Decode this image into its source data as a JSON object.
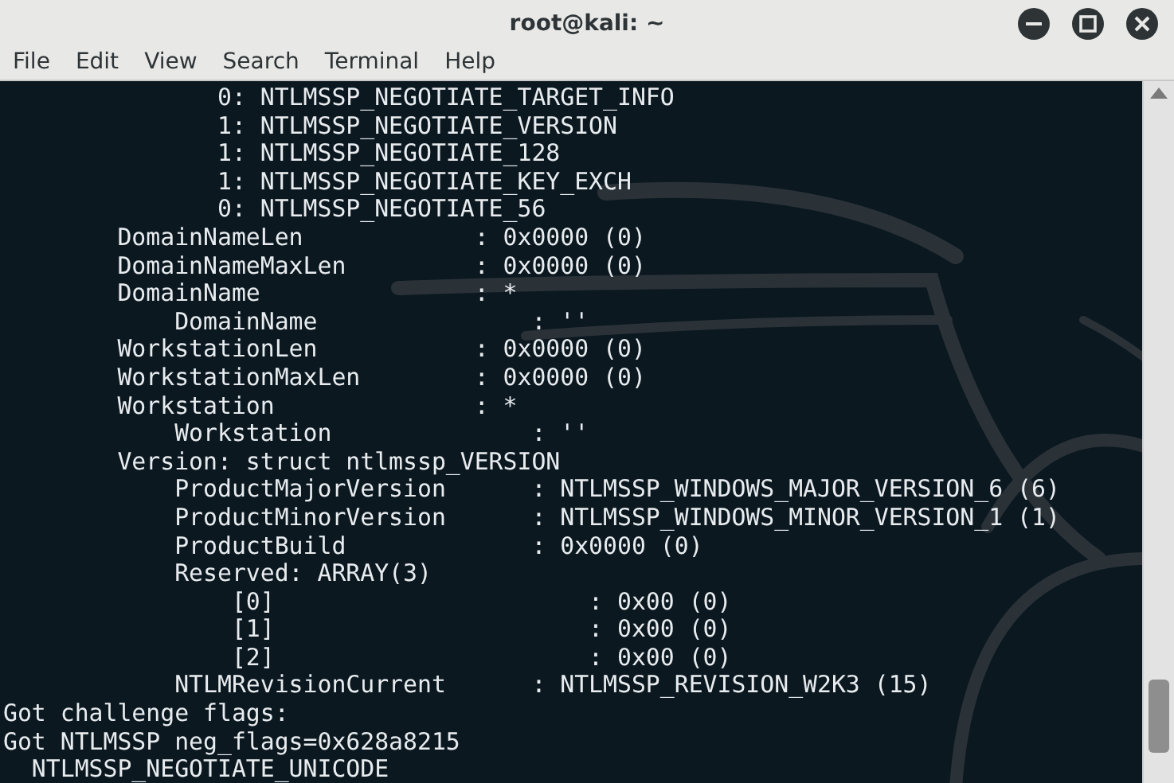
{
  "window": {
    "title": "root@kali: ~"
  },
  "menu": [
    "File",
    "Edit",
    "View",
    "Search",
    "Terminal",
    "Help"
  ],
  "terminal": {
    "lines": [
      "               0: NTLMSSP_NEGOTIATE_TARGET_INFO",
      "               1: NTLMSSP_NEGOTIATE_VERSION",
      "               1: NTLMSSP_NEGOTIATE_128",
      "               1: NTLMSSP_NEGOTIATE_KEY_EXCH",
      "               0: NTLMSSP_NEGOTIATE_56",
      "        DomainNameLen            : 0x0000 (0)",
      "        DomainNameMaxLen         : 0x0000 (0)",
      "        DomainName               : *",
      "            DomainName               : ''",
      "        WorkstationLen           : 0x0000 (0)",
      "        WorkstationMaxLen        : 0x0000 (0)",
      "        Workstation              : *",
      "            Workstation              : ''",
      "        Version: struct ntlmssp_VERSION",
      "            ProductMajorVersion      : NTLMSSP_WINDOWS_MAJOR_VERSION_6 (6)",
      "            ProductMinorVersion      : NTLMSSP_WINDOWS_MINOR_VERSION_1 (1)",
      "            ProductBuild             : 0x0000 (0)",
      "            Reserved: ARRAY(3)",
      "                [0]                      : 0x00 (0)",
      "                [1]                      : 0x00 (0)",
      "                [2]                      : 0x00 (0)",
      "            NTLMRevisionCurrent      : NTLMSSP_REVISION_W2K3 (15)",
      "Got challenge flags:",
      "Got NTLMSSP neg_flags=0x628a8215",
      "  NTLMSSP_NEGOTIATE_UNICODE"
    ]
  }
}
